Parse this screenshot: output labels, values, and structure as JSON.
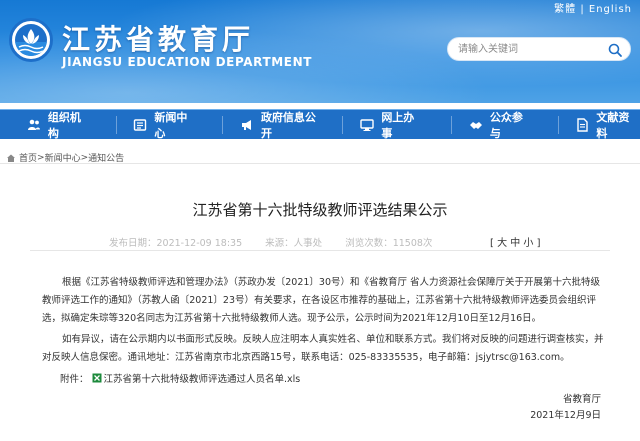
{
  "header": {
    "site_title": "江苏省教育厅",
    "site_subtitle": "JIANGSU EDUCATION DEPARTMENT",
    "top_links": "繁體 | English",
    "search_placeholder": "请输入关键词",
    "search_icon": "search-icon",
    "logo_icon": "education-department-logo"
  },
  "nav": {
    "items": [
      {
        "label": "组织机构",
        "icon": "people-icon"
      },
      {
        "label": "新闻中心",
        "icon": "news-icon"
      },
      {
        "label": "政府信息公开",
        "icon": "megaphone-icon"
      },
      {
        "label": "网上办事",
        "icon": "monitor-icon"
      },
      {
        "label": "公众参与",
        "icon": "handshake-icon"
      },
      {
        "label": "文献资料",
        "icon": "document-icon"
      }
    ],
    "bg_color": "#1f6fc6"
  },
  "breadcrumb": {
    "home": "首页",
    "level1": "新闻中心",
    "level2": "通知公告",
    "sep": ">"
  },
  "article": {
    "title": "江苏省第十六批特级教师评选结果公示",
    "published": "发布日期：2021-12-09 18:35",
    "source": "来源：人事处",
    "views": "浏览次数：11508次",
    "font_size_label": "[ 大 中 小 ]",
    "paragraph1": "根据《江苏省特级教师评选和管理办法》（苏政办发〔2021〕30号）和《省教育厅 省人力资源社会保障厅关于开展第十六批特级教师评选工作的通知》（苏教人函〔2021〕23号）有关要求，在各设区市推荐的基础上，江苏省第十六批特级教师评选委员会组织评选，拟确定朱琮等320名同志为江苏省第十六批特级教师人选。现予公示，公示时间为2021年12月10日至12月16日。",
    "paragraph2": "如有异议，请在公示期内以书面形式反映。反映人应注明本人真实姓名、单位和联系方式。我们将对反映的问题进行调查核实，并对反映人信息保密。通讯地址：江苏省南京市北京西路15号，联系电话：025-83335535，电子邮箱：jsjytrsc@163.com。",
    "attachment_label": "附件：",
    "attachment_file": "江苏省第十六批特级教师评选通过人员名单.xls",
    "signature_org": "省教育厅",
    "signature_date": "2021年12月9日"
  }
}
